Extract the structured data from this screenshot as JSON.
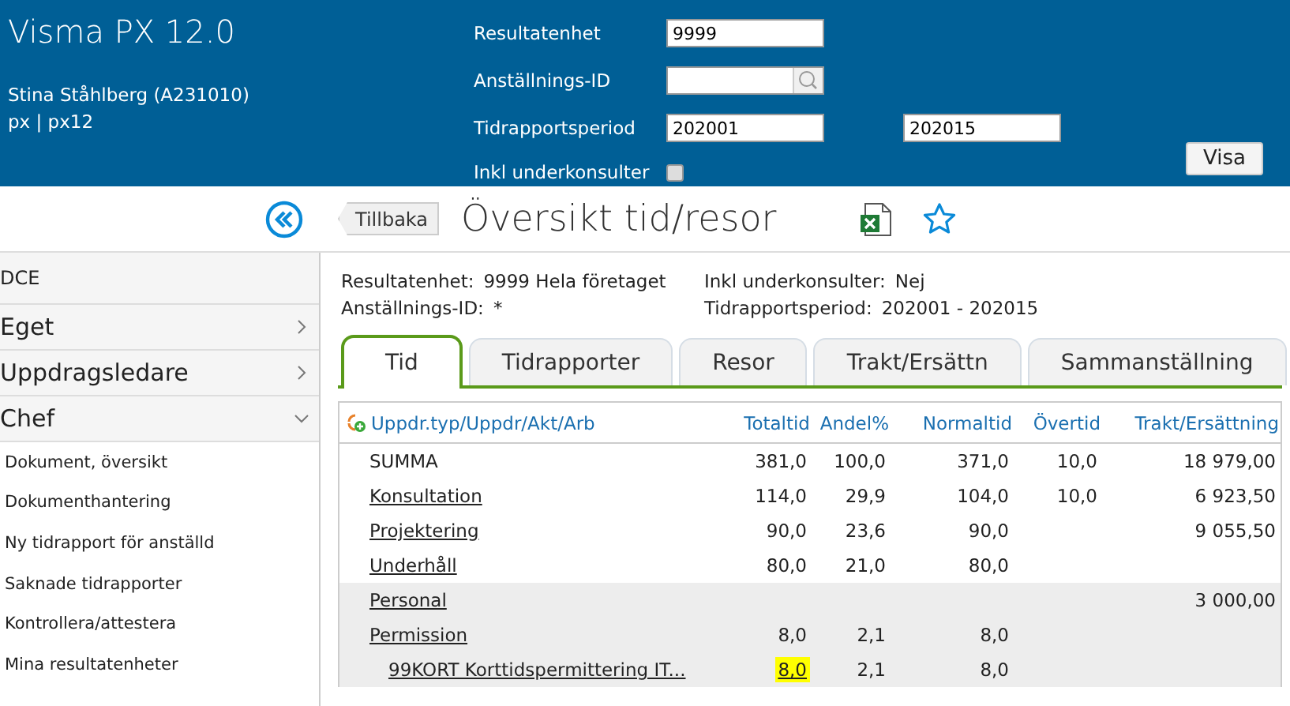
{
  "header": {
    "app_title": "Visma PX 12.0",
    "user": "Stina Ståhlberg (A231010)",
    "context": "px | px12",
    "fields": [
      {
        "label": "Resultatenhet",
        "kind": "text",
        "values": [
          "9999"
        ]
      },
      {
        "label": "Anställnings-ID",
        "kind": "lookup"
      },
      {
        "label": "Tidrapportsperiod",
        "kind": "range",
        "values": [
          "202001",
          "202015"
        ]
      },
      {
        "label": "Inkl underkonsulter",
        "kind": "checkbox",
        "checked": false
      }
    ],
    "show_button": "Visa"
  },
  "toolbar": {
    "back_button": "Tillbaka",
    "page_title": "Översikt tid/resor"
  },
  "sidebar": {
    "heading": "DCE",
    "items": [
      {
        "label": "Eget",
        "expanded": false
      },
      {
        "label": "Uppdragsledare",
        "expanded": false
      },
      {
        "label": "Chef",
        "expanded": true,
        "children": [
          {
            "label": "Dokument, översikt"
          },
          {
            "label": "Dokumenthantering"
          },
          {
            "label": "Ny tidrapport för anställd"
          },
          {
            "label": "Saknade tidrapporter"
          },
          {
            "label": "Kontrollera/attestera"
          },
          {
            "label": "Mina resultatenheter"
          }
        ]
      }
    ]
  },
  "summary": [
    {
      "label": "Resultatenhet:",
      "value": "9999 Hela företaget"
    },
    {
      "label": "Inkl underkonsulter:",
      "value": "Nej"
    },
    {
      "label": "Anställnings-ID:",
      "value": "*"
    },
    {
      "label": "Tidrapportsperiod:",
      "value": "202001 - 202015"
    }
  ],
  "tabs": [
    {
      "label": "Tid",
      "selected": true
    },
    {
      "label": "Tidrapporter",
      "selected": false
    },
    {
      "label": "Resor",
      "selected": false
    },
    {
      "label": "Trakt/Ersättn",
      "selected": false
    },
    {
      "label": "Sammanställning",
      "selected": false
    }
  ],
  "table": {
    "columns": [
      "Uppdr.typ/Uppdr/Akt/Arb",
      "Totaltid",
      "Andel%",
      "Normaltid",
      "Övertid",
      "Trakt/Ersättning"
    ],
    "rows": [
      {
        "link": false,
        "shaded": false,
        "totaltid_highlighted": false,
        "cells": [
          "SUMMA",
          "381,0",
          "100,0",
          "371,0",
          "10,0",
          "18 979,00"
        ]
      },
      {
        "link": true,
        "shaded": false,
        "totaltid_highlighted": false,
        "cells": [
          "Konsultation",
          "114,0",
          "29,9",
          "104,0",
          "10,0",
          "6 923,50"
        ]
      },
      {
        "link": true,
        "shaded": false,
        "totaltid_highlighted": false,
        "cells": [
          "Projektering",
          "90,0",
          "23,6",
          "90,0",
          "",
          "9 055,50"
        ]
      },
      {
        "link": true,
        "shaded": false,
        "totaltid_highlighted": false,
        "cells": [
          "Underhåll",
          "80,0",
          "21,0",
          "80,0",
          "",
          ""
        ]
      },
      {
        "link": true,
        "shaded": true,
        "cells": [
          "Personal",
          "",
          "",
          "",
          "",
          "3 000,00"
        ]
      },
      {
        "link": true,
        "shaded": true,
        "totaltid_highlighted": false,
        "cells": [
          "Permission",
          "8,0",
          "2,1",
          "8,0",
          "",
          ""
        ],
        "children": [
          {
            "link": true,
            "shaded": true,
            "totaltid_highlighted": true,
            "cells": [
              "99KORT Korttidspermittering IT...",
              "8,0",
              "2,1",
              "8,0",
              "",
              ""
            ]
          }
        ]
      }
    ]
  }
}
